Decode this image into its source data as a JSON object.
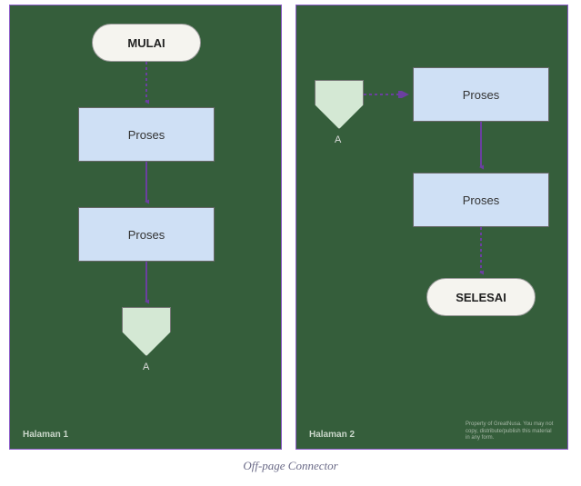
{
  "caption": "Off-page Connector",
  "page1": {
    "label": "Halaman 1",
    "start": "MULAI",
    "process1": "Proses",
    "process2": "Proses",
    "connector_ref": "A"
  },
  "page2": {
    "label": "Halaman 2",
    "connector_ref": "A",
    "process1": "Proses",
    "process2": "Proses",
    "end": "SELESAI",
    "footnote": "Property of GreatNusa. You may not copy, distribute/publish this material in any form."
  },
  "chart_data": {
    "type": "diagram",
    "title": "Off-page Connector",
    "pages": [
      {
        "name": "Halaman 1",
        "nodes": [
          {
            "id": "start",
            "type": "terminator",
            "label": "MULAI"
          },
          {
            "id": "p1",
            "type": "process",
            "label": "Proses"
          },
          {
            "id": "p2",
            "type": "process",
            "label": "Proses"
          },
          {
            "id": "offA1",
            "type": "offpage-connector",
            "label": "A"
          }
        ],
        "edges": [
          {
            "from": "start",
            "to": "p1",
            "style": "dashed"
          },
          {
            "from": "p1",
            "to": "p2",
            "style": "solid"
          },
          {
            "from": "p2",
            "to": "offA1",
            "style": "solid"
          }
        ]
      },
      {
        "name": "Halaman 2",
        "nodes": [
          {
            "id": "offA2",
            "type": "offpage-connector",
            "label": "A"
          },
          {
            "id": "p3",
            "type": "process",
            "label": "Proses"
          },
          {
            "id": "p4",
            "type": "process",
            "label": "Proses"
          },
          {
            "id": "end",
            "type": "terminator",
            "label": "SELESAI"
          }
        ],
        "edges": [
          {
            "from": "offA2",
            "to": "p3",
            "style": "dashed"
          },
          {
            "from": "p3",
            "to": "p4",
            "style": "solid"
          },
          {
            "from": "p4",
            "to": "end",
            "style": "dashed"
          }
        ]
      }
    ]
  }
}
